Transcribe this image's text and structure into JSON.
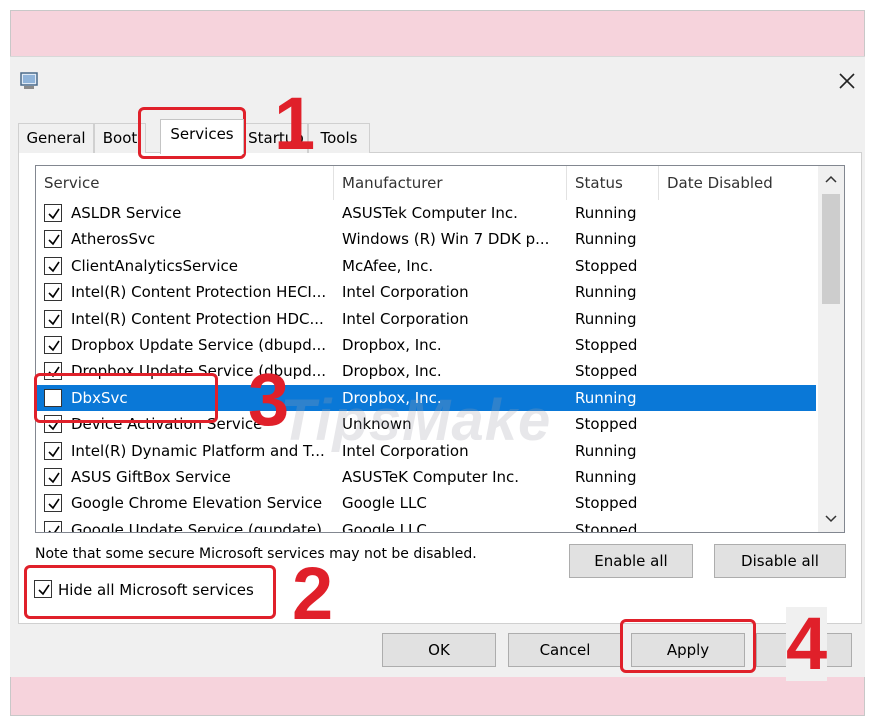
{
  "window": {
    "tabs": [
      {
        "label": "General"
      },
      {
        "label": "Boot"
      },
      {
        "label": "Services"
      },
      {
        "label": "Startup"
      },
      {
        "label": "Tools"
      }
    ],
    "active_tab": "Services"
  },
  "services_list": {
    "columns": [
      "Service",
      "Manufacturer",
      "Status",
      "Date Disabled"
    ],
    "rows": [
      {
        "name": "ASLDR Service",
        "manufacturer": "ASUSTek Computer Inc.",
        "status": "Running",
        "checked": true
      },
      {
        "name": "AtherosSvc",
        "manufacturer": "Windows (R) Win 7 DDK p...",
        "status": "Running",
        "checked": true
      },
      {
        "name": "ClientAnalyticsService",
        "manufacturer": "McAfee, Inc.",
        "status": "Stopped",
        "checked": true
      },
      {
        "name": "Intel(R) Content Protection HECI...",
        "manufacturer": "Intel Corporation",
        "status": "Running",
        "checked": true
      },
      {
        "name": "Intel(R) Content Protection HDC...",
        "manufacturer": "Intel Corporation",
        "status": "Running",
        "checked": true
      },
      {
        "name": "Dropbox Update Service (dbupd...",
        "manufacturer": "Dropbox, Inc.",
        "status": "Stopped",
        "checked": true
      },
      {
        "name": "Dropbox Update Service (dbupd...",
        "manufacturer": "Dropbox, Inc.",
        "status": "Stopped",
        "checked": true
      },
      {
        "name": "DbxSvc",
        "manufacturer": "Dropbox, Inc.",
        "status": "Running",
        "checked": false,
        "selected": true
      },
      {
        "name": "Device Activation Service",
        "manufacturer": "Unknown",
        "status": "Stopped",
        "checked": true
      },
      {
        "name": "Intel(R) Dynamic Platform and T...",
        "manufacturer": "Intel Corporation",
        "status": "Running",
        "checked": true
      },
      {
        "name": "ASUS GiftBox Service",
        "manufacturer": "ASUSTeK Computer Inc.",
        "status": "Running",
        "checked": true
      },
      {
        "name": "Google Chrome Elevation Service",
        "manufacturer": "Google LLC",
        "status": "Stopped",
        "checked": true
      },
      {
        "name": "Google Update Service (gupdate)",
        "manufacturer": "Google LLC",
        "status": "Stopped",
        "checked": true
      }
    ]
  },
  "note": "Note that some secure Microsoft services may not be disabled.",
  "buttons": {
    "enable_all": "Enable all",
    "disable_all": "Disable all",
    "ok": "OK",
    "cancel": "Cancel",
    "apply": "Apply",
    "help": "Help"
  },
  "hide_ms": {
    "label": "Hide all Microsoft services",
    "checked": true
  },
  "annotations": [
    "1",
    "2",
    "3",
    "4"
  ],
  "watermark": "TipsMake",
  "colors": {
    "annotation": "#e0202a",
    "selection": "#0a78d7",
    "background_band": "#f6d3dc"
  }
}
